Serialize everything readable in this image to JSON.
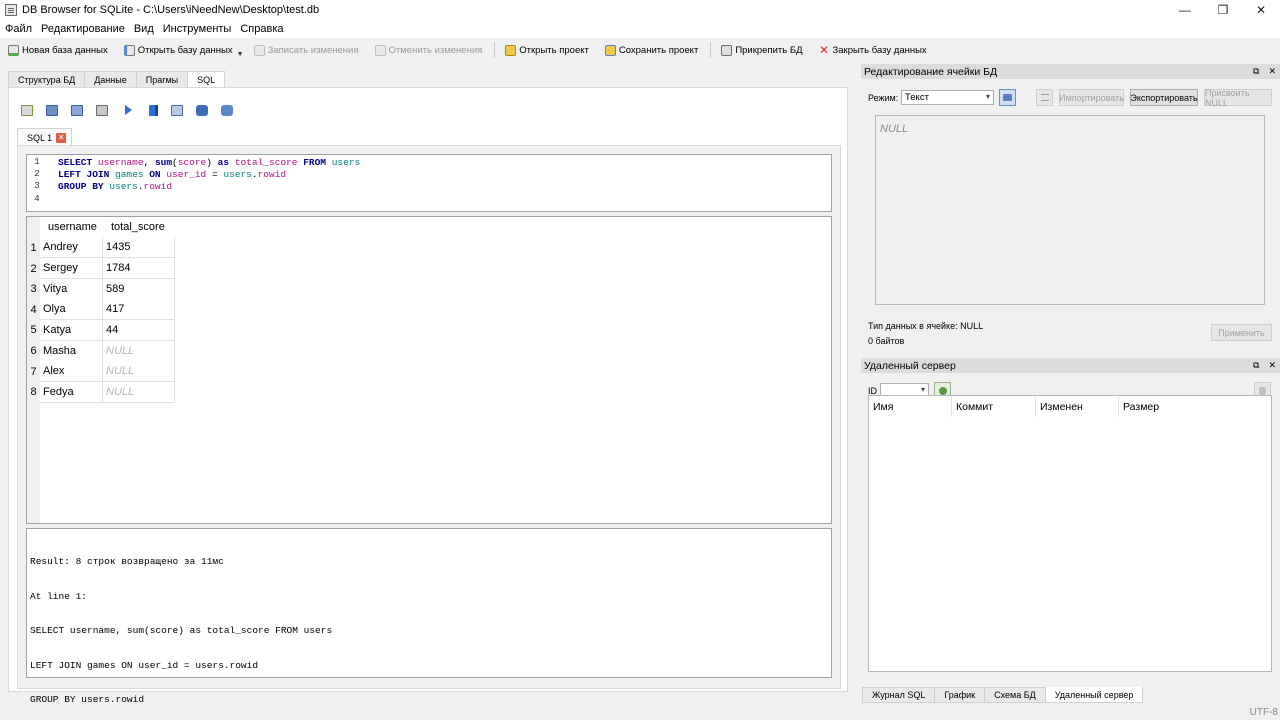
{
  "window": {
    "title": "DB Browser for SQLite - C:\\Users\\iNeedNew\\Desktop\\test.db",
    "minimize": "—",
    "restore": "❐",
    "close": "✕"
  },
  "menu": [
    "Файл",
    "Редактирование",
    "Вид",
    "Инструменты",
    "Справка"
  ],
  "toolbar": {
    "new_db": "Новая база данных",
    "open_db": "Открыть базу данных",
    "write_changes": "Записать изменения",
    "revert_changes": "Отменить изменения",
    "open_project": "Открыть проект",
    "save_project": "Сохранить проект",
    "attach_db": "Прикрепить БД",
    "close_db": "Закрыть базу данных"
  },
  "tabs": [
    "Структура БД",
    "Данные",
    "Прагмы",
    "SQL"
  ],
  "active_tab": "SQL",
  "sql_tab": {
    "label": "SQL 1",
    "close": "✕"
  },
  "editor": {
    "line_numbers": [
      "1",
      "2",
      "3",
      "4"
    ]
  },
  "results": {
    "columns": [
      "username",
      "total_score"
    ],
    "rows": [
      {
        "n": "1",
        "username": "Andrey",
        "total_score": "1435"
      },
      {
        "n": "2",
        "username": "Sergey",
        "total_score": "1784"
      },
      {
        "n": "3",
        "username": "Vitya",
        "total_score": "589"
      },
      {
        "n": "4",
        "username": "Olya",
        "total_score": "417"
      },
      {
        "n": "5",
        "username": "Katya",
        "total_score": "44"
      },
      {
        "n": "6",
        "username": "Masha",
        "total_score": "NULL"
      },
      {
        "n": "7",
        "username": "Alex",
        "total_score": "NULL"
      },
      {
        "n": "8",
        "username": "Fedya",
        "total_score": "NULL"
      }
    ]
  },
  "message": {
    "line1": "Result: 8 строк возвращено за 11мс",
    "line2": "At line 1:",
    "line3": "SELECT username, sum(score) as total_score FROM users",
    "line4": "LEFT JOIN games ON user_id = users.rowid",
    "line5": "GROUP BY users.rowid"
  },
  "cell_editor": {
    "title": "Редактирование ячейки БД",
    "mode_label": "Режим:",
    "mode_value": "Текст",
    "import": "Импортировать",
    "export": "Экспортировать",
    "set_null": "Присвоить NULL",
    "content": "NULL",
    "type_info": "Тип данных в ячейке: NULL",
    "size_info": "0 байтов",
    "apply": "Применить",
    "float_icon": "⧉",
    "close_icon": "✕"
  },
  "remote": {
    "title": "Удаленный сервер",
    "id_label": "ID",
    "columns": [
      "Имя",
      "Коммит",
      "Изменен",
      "Размер"
    ],
    "float_icon": "⧉",
    "close_icon": "✕"
  },
  "bottom_tabs": [
    "Журнал SQL",
    "График",
    "Схема БД",
    "Удаленный сервер"
  ],
  "active_bottom_tab": "Удаленный сервер",
  "status": {
    "encoding": "UTF-8"
  },
  "colors": {
    "keyword": "#000080",
    "identifier": "#b0108a",
    "table": "#008080",
    "null_text": "#b5b5b5"
  }
}
